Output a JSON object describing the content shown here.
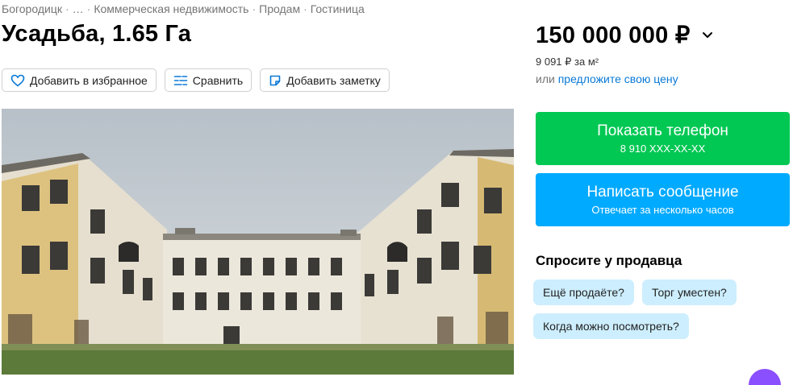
{
  "breadcrumbs": [
    "Богородицк",
    "…",
    "Коммерческая недвижимость",
    "Продам",
    "Гостиница"
  ],
  "title": "Усадьба, 1.65 Га",
  "actions": {
    "favorite": "Добавить в избранное",
    "compare": "Сравнить",
    "note": "Добавить заметку"
  },
  "icons": {
    "favorite": "heart-icon",
    "compare": "compare-icon",
    "note": "note-icon",
    "price_toggle": "chevron-down-icon"
  },
  "price": {
    "value": "150 000 000 ₽",
    "per_m2": "9 091 ₽ за м²",
    "offer_prefix": "или",
    "offer_link": "предложите свою цену"
  },
  "contact": {
    "phone_label": "Показать телефон",
    "phone_number": "8 910 XXX-XX-XX",
    "message_label": "Написать сообщение",
    "message_sub": "Отвечает за несколько часов"
  },
  "ask_seller": {
    "title": "Спросите у продавца",
    "chips": [
      "Ещё продаёте?",
      "Торг уместен?",
      "Когда можно посмотреть?"
    ]
  },
  "colors": {
    "phone_button": "#00c853",
    "message_button": "#00aaff",
    "link": "#0a79d6",
    "chip": "#cdeefe"
  }
}
